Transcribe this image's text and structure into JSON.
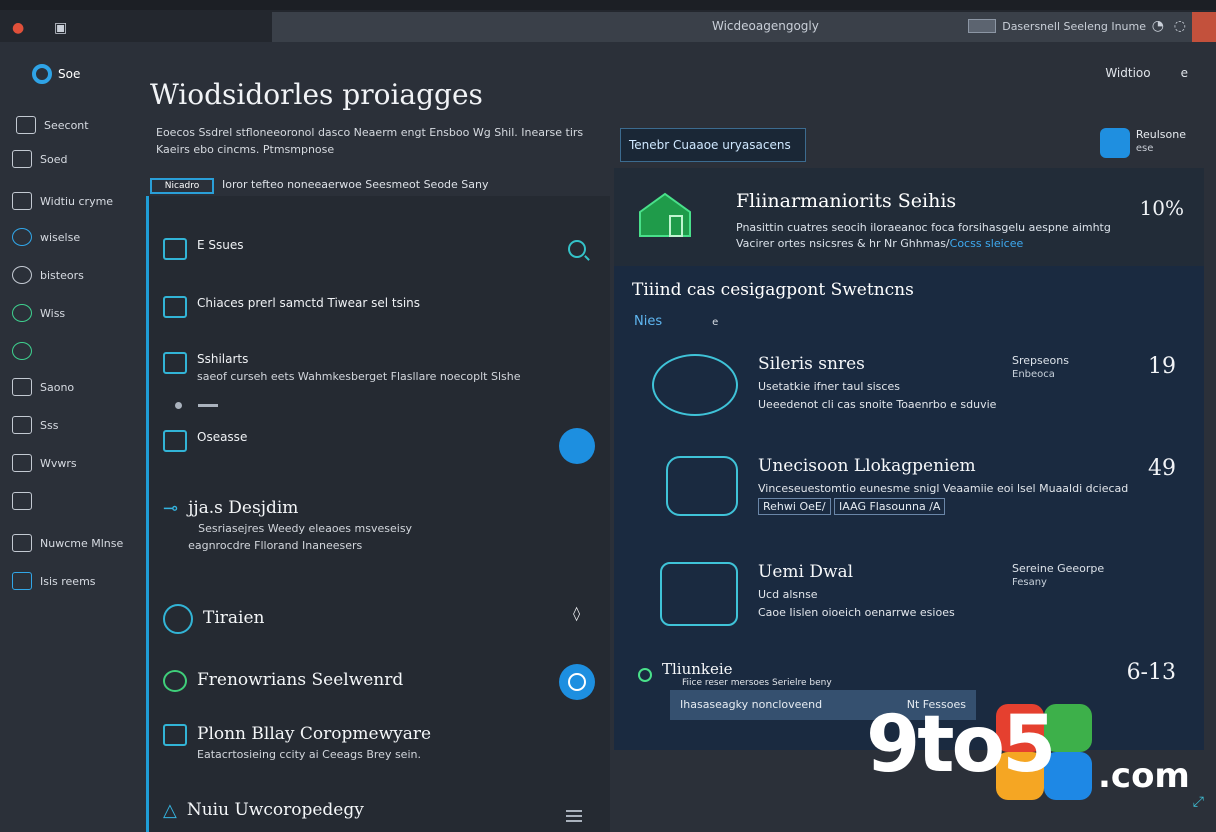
{
  "window": {
    "title": "Wicdeoagengogly",
    "right_label": "Dasersnell Seeleng Inume",
    "close_color": "#c3513c"
  },
  "sidebar": {
    "logo_label": "Soe",
    "items": [
      {
        "label": "Seecont",
        "icon": "monitor-icon"
      },
      {
        "label": "Soed",
        "icon": "document-icon"
      },
      {
        "label": "Widtiu cryme",
        "icon": "window-icon"
      },
      {
        "label": "wiselse",
        "icon": "circle-info-icon"
      },
      {
        "label": "bisteors",
        "icon": "users-icon"
      },
      {
        "label": "Wiss",
        "icon": "globe-icon"
      },
      {
        "label": "",
        "icon": "chat-icon"
      },
      {
        "label": "Saono",
        "icon": "gear-icon"
      },
      {
        "label": "Sss",
        "icon": "pin-icon"
      },
      {
        "label": "Wvwrs",
        "icon": "terminal-icon"
      },
      {
        "label": "",
        "icon": "chart-icon"
      },
      {
        "label": "Nuwcme Mlnse",
        "icon": "person-icon"
      },
      {
        "label": "Isis reems",
        "icon": "folder-icon"
      }
    ]
  },
  "main": {
    "heading": "Wiodsidorles proiagges",
    "subtext_1": "Eoecos Ssdrel stfloneeoronol dasco  Neaerm engt Ensboo Wg Shil. Inearse tirs",
    "subtext_2": "Kaeirs ebo cincms. Ptmsmpnose",
    "tag_button": "Nicadro",
    "tag_caption": "Ioror tefteo noneeaerwoe Seesmeot Seode Sany"
  },
  "left_panel": {
    "rows": [
      {
        "title": "E Ssues",
        "desc": ""
      },
      {
        "title": "Chiaces prerl samctd Tiwear sel tsins",
        "desc": ""
      },
      {
        "title": "Sshilarts",
        "desc": "saeof curseh eets Wahmkesberget Flasllare noecoplt Slshe"
      },
      {
        "title": "Oseasse",
        "desc": ""
      },
      {
        "title": "jja.s Desjdim",
        "desc": "Sesriasejres Weedy eleaoes msveseisy"
      },
      {
        "title": "",
        "desc": "eagnrocdre Fllorand Inaneesers"
      },
      {
        "title": "Tiraien",
        "desc": ""
      },
      {
        "title": "Frenowrians Seelwenrd",
        "desc": ""
      },
      {
        "title": "Plonn Bllay Coropmewyare",
        "desc": "Eatacrtosieing ccity ai Ceeags Brey sein."
      },
      {
        "title": "Nuiu Uwcoropedegy",
        "desc": ""
      }
    ]
  },
  "right_top": {
    "tab_label": "Tenebr Cuaaoe uryasacens",
    "wh_label": "Widtioo",
    "wh_extra": "e",
    "profile_name": "Reulsone",
    "profile_sub": "ese"
  },
  "right_panel": {
    "header_title": "Fliinarmaniorits Seihis",
    "header_desc_1": "Pnasittin cuatres seocih iloraeanoc foca forsihasgelu aespne aimhtg",
    "header_desc_2": "Vacirer ortes nsicsres & hr Nr Ghhmas/",
    "header_desc_link": "Cocss sleicee",
    "header_num": "10%",
    "section_title": "Tiiind cas cesigagpont Swetncns",
    "filter_label": "Nies",
    "filter_dot": "e",
    "items": [
      {
        "title": "Sileris snres",
        "d1": "Usetatkie ifner taul sisces",
        "d2": "Ueeedenot cli cas snoite Toaenrbo e sduvie",
        "side1": "Srepseons",
        "side2": "Enbeoca",
        "num": "19"
      },
      {
        "title": "Unecisoon Llokagpeniem",
        "d1": "Vinceseuestomtio eunesme snigl Veaamiie eoi lsel Muaaldi dciecad",
        "d2": "",
        "chips": [
          "Rehwi OeE/",
          "IAAG Flasounna /A"
        ],
        "side1": "",
        "side2": "",
        "num": "49"
      },
      {
        "title": "Uemi Dwal",
        "d1": "Ucd alsnse",
        "d2": "Caoe Iislen oioeich oenarrwe esioes",
        "side1": "Sereine Geeorpe",
        "side2": "Fesany",
        "num": ""
      },
      {
        "title": "Tliunkeie",
        "d1": "Fiice reser mersoes",
        "d2": "Serielre beny",
        "side1": "",
        "side2": "",
        "num": "6-13"
      }
    ],
    "bar_left": "Ihasaseagky noncloveend",
    "bar_right": "Nt Fessoes"
  },
  "brand": {
    "text": "9to5",
    "suffix": ".com",
    "tile_colors": [
      "#e5402f",
      "#f5a623",
      "#3db04a",
      "#1e88e5"
    ]
  }
}
